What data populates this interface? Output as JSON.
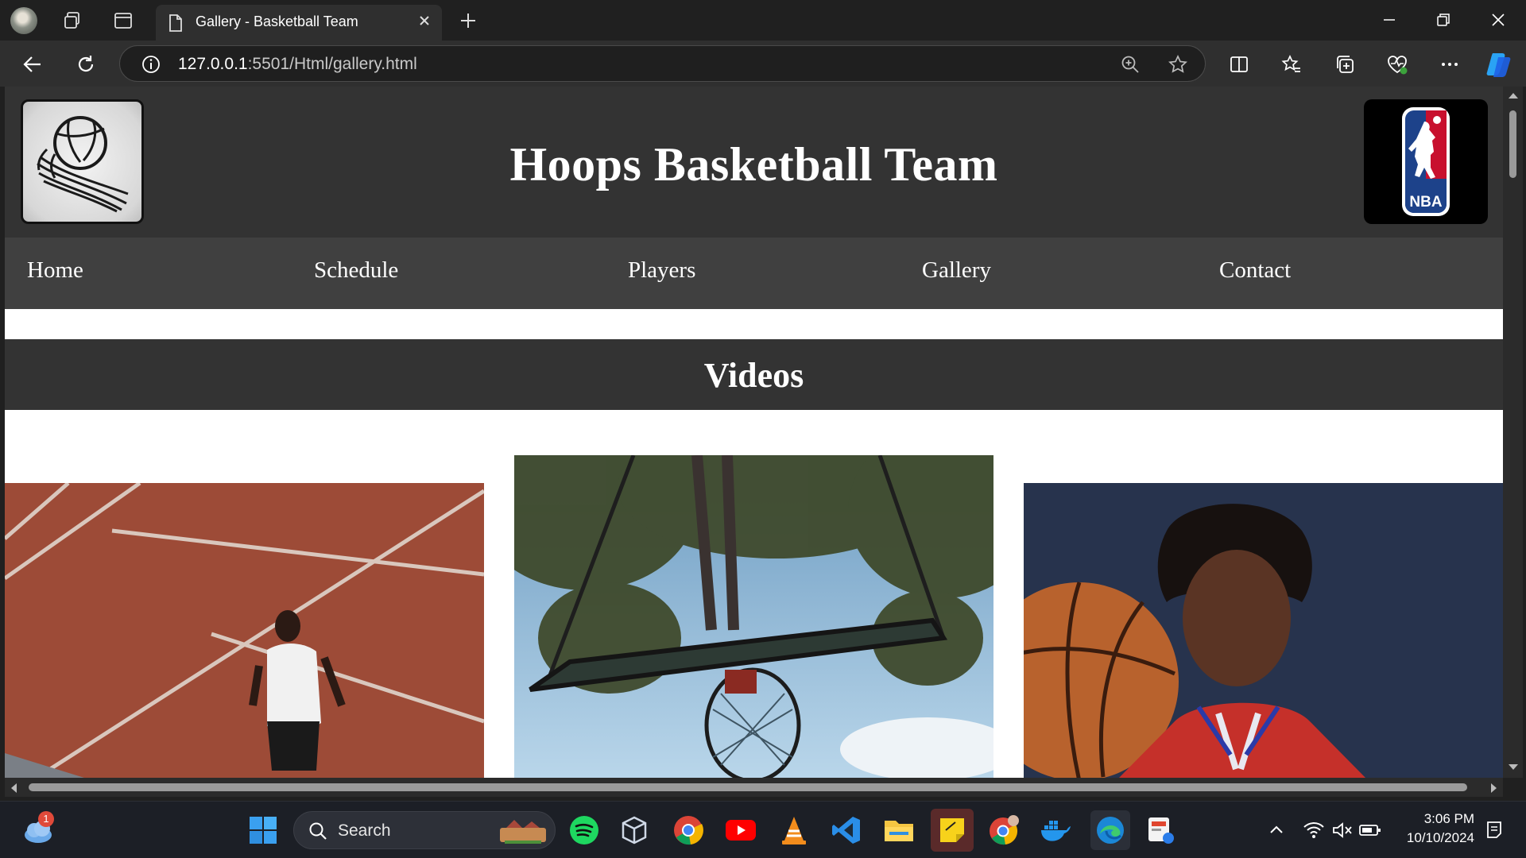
{
  "browser": {
    "tab": {
      "title": "Gallery - Basketball Team"
    },
    "address": {
      "host": "127.0.0.1",
      "path": ":5501/Html/gallery.html"
    }
  },
  "site": {
    "title": "Hoops Basketball Team",
    "nba_text": "NBA",
    "nav": [
      {
        "label": "Home"
      },
      {
        "label": "Schedule"
      },
      {
        "label": "Players"
      },
      {
        "label": "Gallery"
      },
      {
        "label": "Contact"
      }
    ],
    "section_title": "Videos"
  },
  "taskbar": {
    "search_label": "Search",
    "weather_badge": "1",
    "time": "3:06 PM",
    "date": "10/10/2024"
  },
  "colors": {
    "header_bg": "#333333",
    "nav_bg": "#404040",
    "accent_edge": "#0078d4"
  }
}
